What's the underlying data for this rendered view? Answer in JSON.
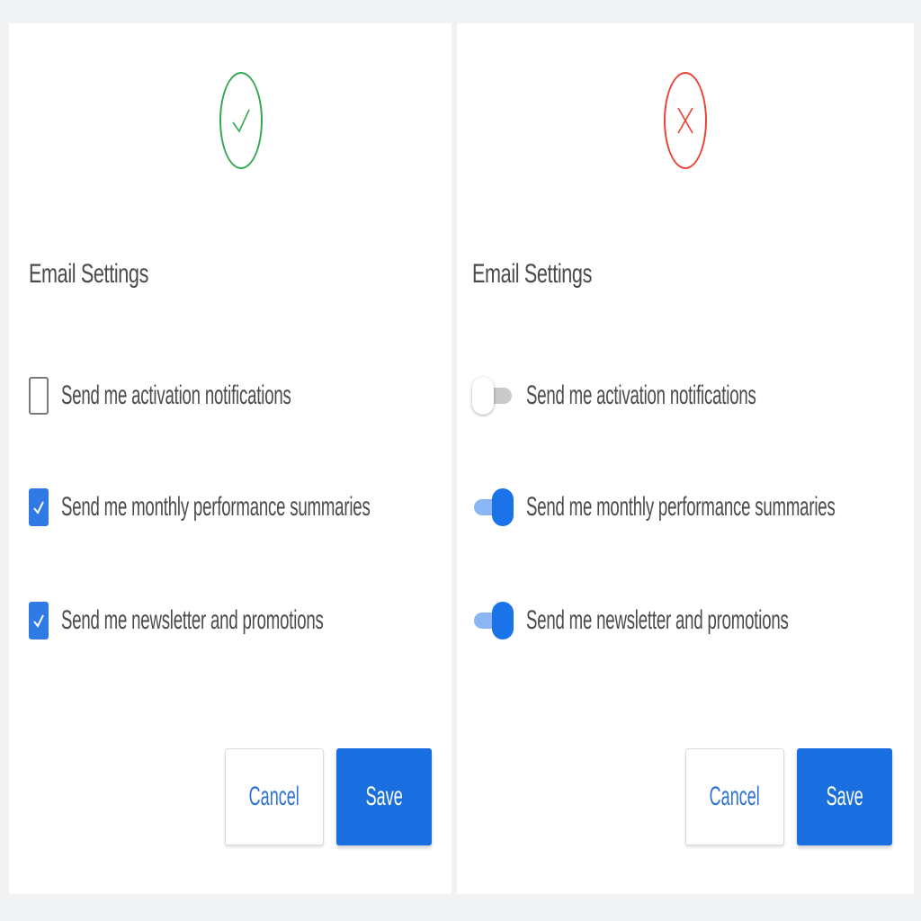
{
  "colors": {
    "do_ring": "#34a853",
    "dont_ring": "#ea4335",
    "accent": "#1a73e8",
    "text": "#4a4a4a"
  },
  "left_panel": {
    "status_icon": "check-icon",
    "title": "Email Settings",
    "options": [
      {
        "label": "Send me activation notifications",
        "checked": false
      },
      {
        "label": "Send me monthly performance summaries",
        "checked": true
      },
      {
        "label": "Send me newsletter and promotions",
        "checked": true
      }
    ],
    "cancel_label": "Cancel",
    "save_label": "Save"
  },
  "right_panel": {
    "status_icon": "x-icon",
    "title": "Email Settings",
    "options": [
      {
        "label": "Send me activation notifications",
        "on": false
      },
      {
        "label": "Send me monthly performance summaries",
        "on": true
      },
      {
        "label": "Send me newsletter and promotions",
        "on": true
      }
    ],
    "cancel_label": "Cancel",
    "save_label": "Save"
  }
}
